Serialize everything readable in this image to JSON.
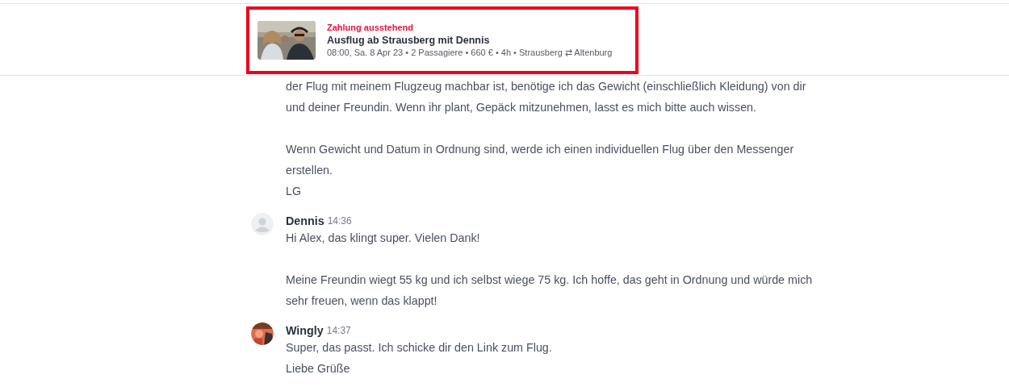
{
  "booking_card": {
    "highlighted": true,
    "status": "Zahlung ausstehend",
    "title": "Ausflug ab Strausberg mit Dennis",
    "details": "08:00, Sa. 8 Apr 23 • 2 Passagiere • 660 € • 4h • Strausberg ⇄ Altenburg",
    "thumbnail": {
      "kind": "picture"
    }
  },
  "messages": [
    {
      "paragraphs": [
        [
          "der Flug mit meinem Flugzeug machbar ist, benötige ich das Gewicht (einschließlich Kleidung) von dir",
          "und deiner Freundin. Wenn ihr plant, Gepäck mitzunehmen, lasst es mich bitte auch wissen."
        ],
        [
          "Wenn Gewicht und Datum in Ordnung sind, werde ich einen individuellen Flug über den Messenger",
          "erstellen.",
          "LG"
        ]
      ]
    },
    {
      "author": "Dennis",
      "time": "14:36",
      "avatar": {
        "kind": "placeholder"
      },
      "paragraphs": [
        [
          "Hi Alex, das klingt super. Vielen Dank!"
        ],
        [
          "Meine Freundin wiegt 55 kg und ich selbst wiege 75 kg. Ich hoffe, das geht in Ordnung und würde mich",
          "sehr freuen, wenn das klappt!"
        ]
      ]
    },
    {
      "author": "Wingly",
      "time": "14:37",
      "avatar": {
        "kind": "picture"
      },
      "paragraphs": [
        [
          "Super, das passt. Ich schicke dir den Link zum Flug.",
          "Liebe Grüße"
        ]
      ]
    }
  ]
}
